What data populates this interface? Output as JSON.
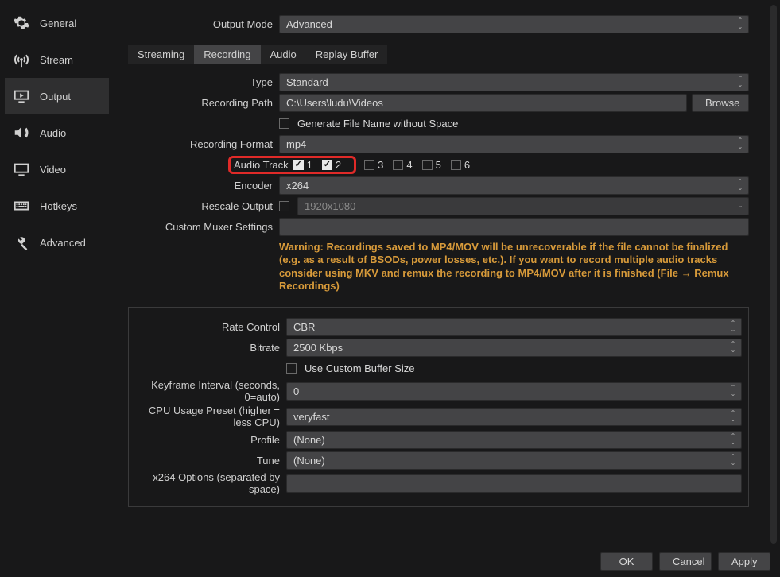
{
  "sidebar": {
    "items": [
      {
        "label": "General"
      },
      {
        "label": "Stream"
      },
      {
        "label": "Output"
      },
      {
        "label": "Audio"
      },
      {
        "label": "Video"
      },
      {
        "label": "Hotkeys"
      },
      {
        "label": "Advanced"
      }
    ],
    "active_index": 2
  },
  "output_mode": {
    "label": "Output Mode",
    "value": "Advanced"
  },
  "tabs": {
    "items": [
      {
        "label": "Streaming"
      },
      {
        "label": "Recording"
      },
      {
        "label": "Audio"
      },
      {
        "label": "Replay Buffer"
      }
    ],
    "active_index": 1
  },
  "recording": {
    "type_label": "Type",
    "type_value": "Standard",
    "path_label": "Recording Path",
    "path_value": "C:\\Users\\ludu\\Videos",
    "browse": "Browse",
    "gen_no_space": "Generate File Name without Space",
    "format_label": "Recording Format",
    "format_value": "mp4",
    "audio_track_label": "Audio Track",
    "tracks": [
      "1",
      "2",
      "3",
      "4",
      "5",
      "6"
    ],
    "tracks_checked": [
      true,
      true,
      false,
      false,
      false,
      false
    ],
    "encoder_label": "Encoder",
    "encoder_value": "x264",
    "rescale_label": "Rescale Output",
    "rescale_value": "1920x1080",
    "muxer_label": "Custom Muxer Settings",
    "warning": "Warning: Recordings saved to MP4/MOV will be unrecoverable if the file cannot be finalized (e.g. as a result of BSODs, power losses, etc.). If you want to record multiple audio tracks consider using MKV and remux the recording to MP4/MOV after it is finished (File → Remux Recordings)"
  },
  "encoder": {
    "rate_control_label": "Rate Control",
    "rate_control_value": "CBR",
    "bitrate_label": "Bitrate",
    "bitrate_value": "2500 Kbps",
    "custom_buffer": "Use Custom Buffer Size",
    "keyframe_label": "Keyframe Interval (seconds, 0=auto)",
    "keyframe_value": "0",
    "cpu_label": "CPU Usage Preset (higher = less CPU)",
    "cpu_value": "veryfast",
    "profile_label": "Profile",
    "profile_value": "(None)",
    "tune_label": "Tune",
    "tune_value": "(None)",
    "x264opts_label": "x264 Options (separated by space)"
  },
  "buttons": {
    "ok": "OK",
    "cancel": "Cancel",
    "apply": "Apply"
  }
}
